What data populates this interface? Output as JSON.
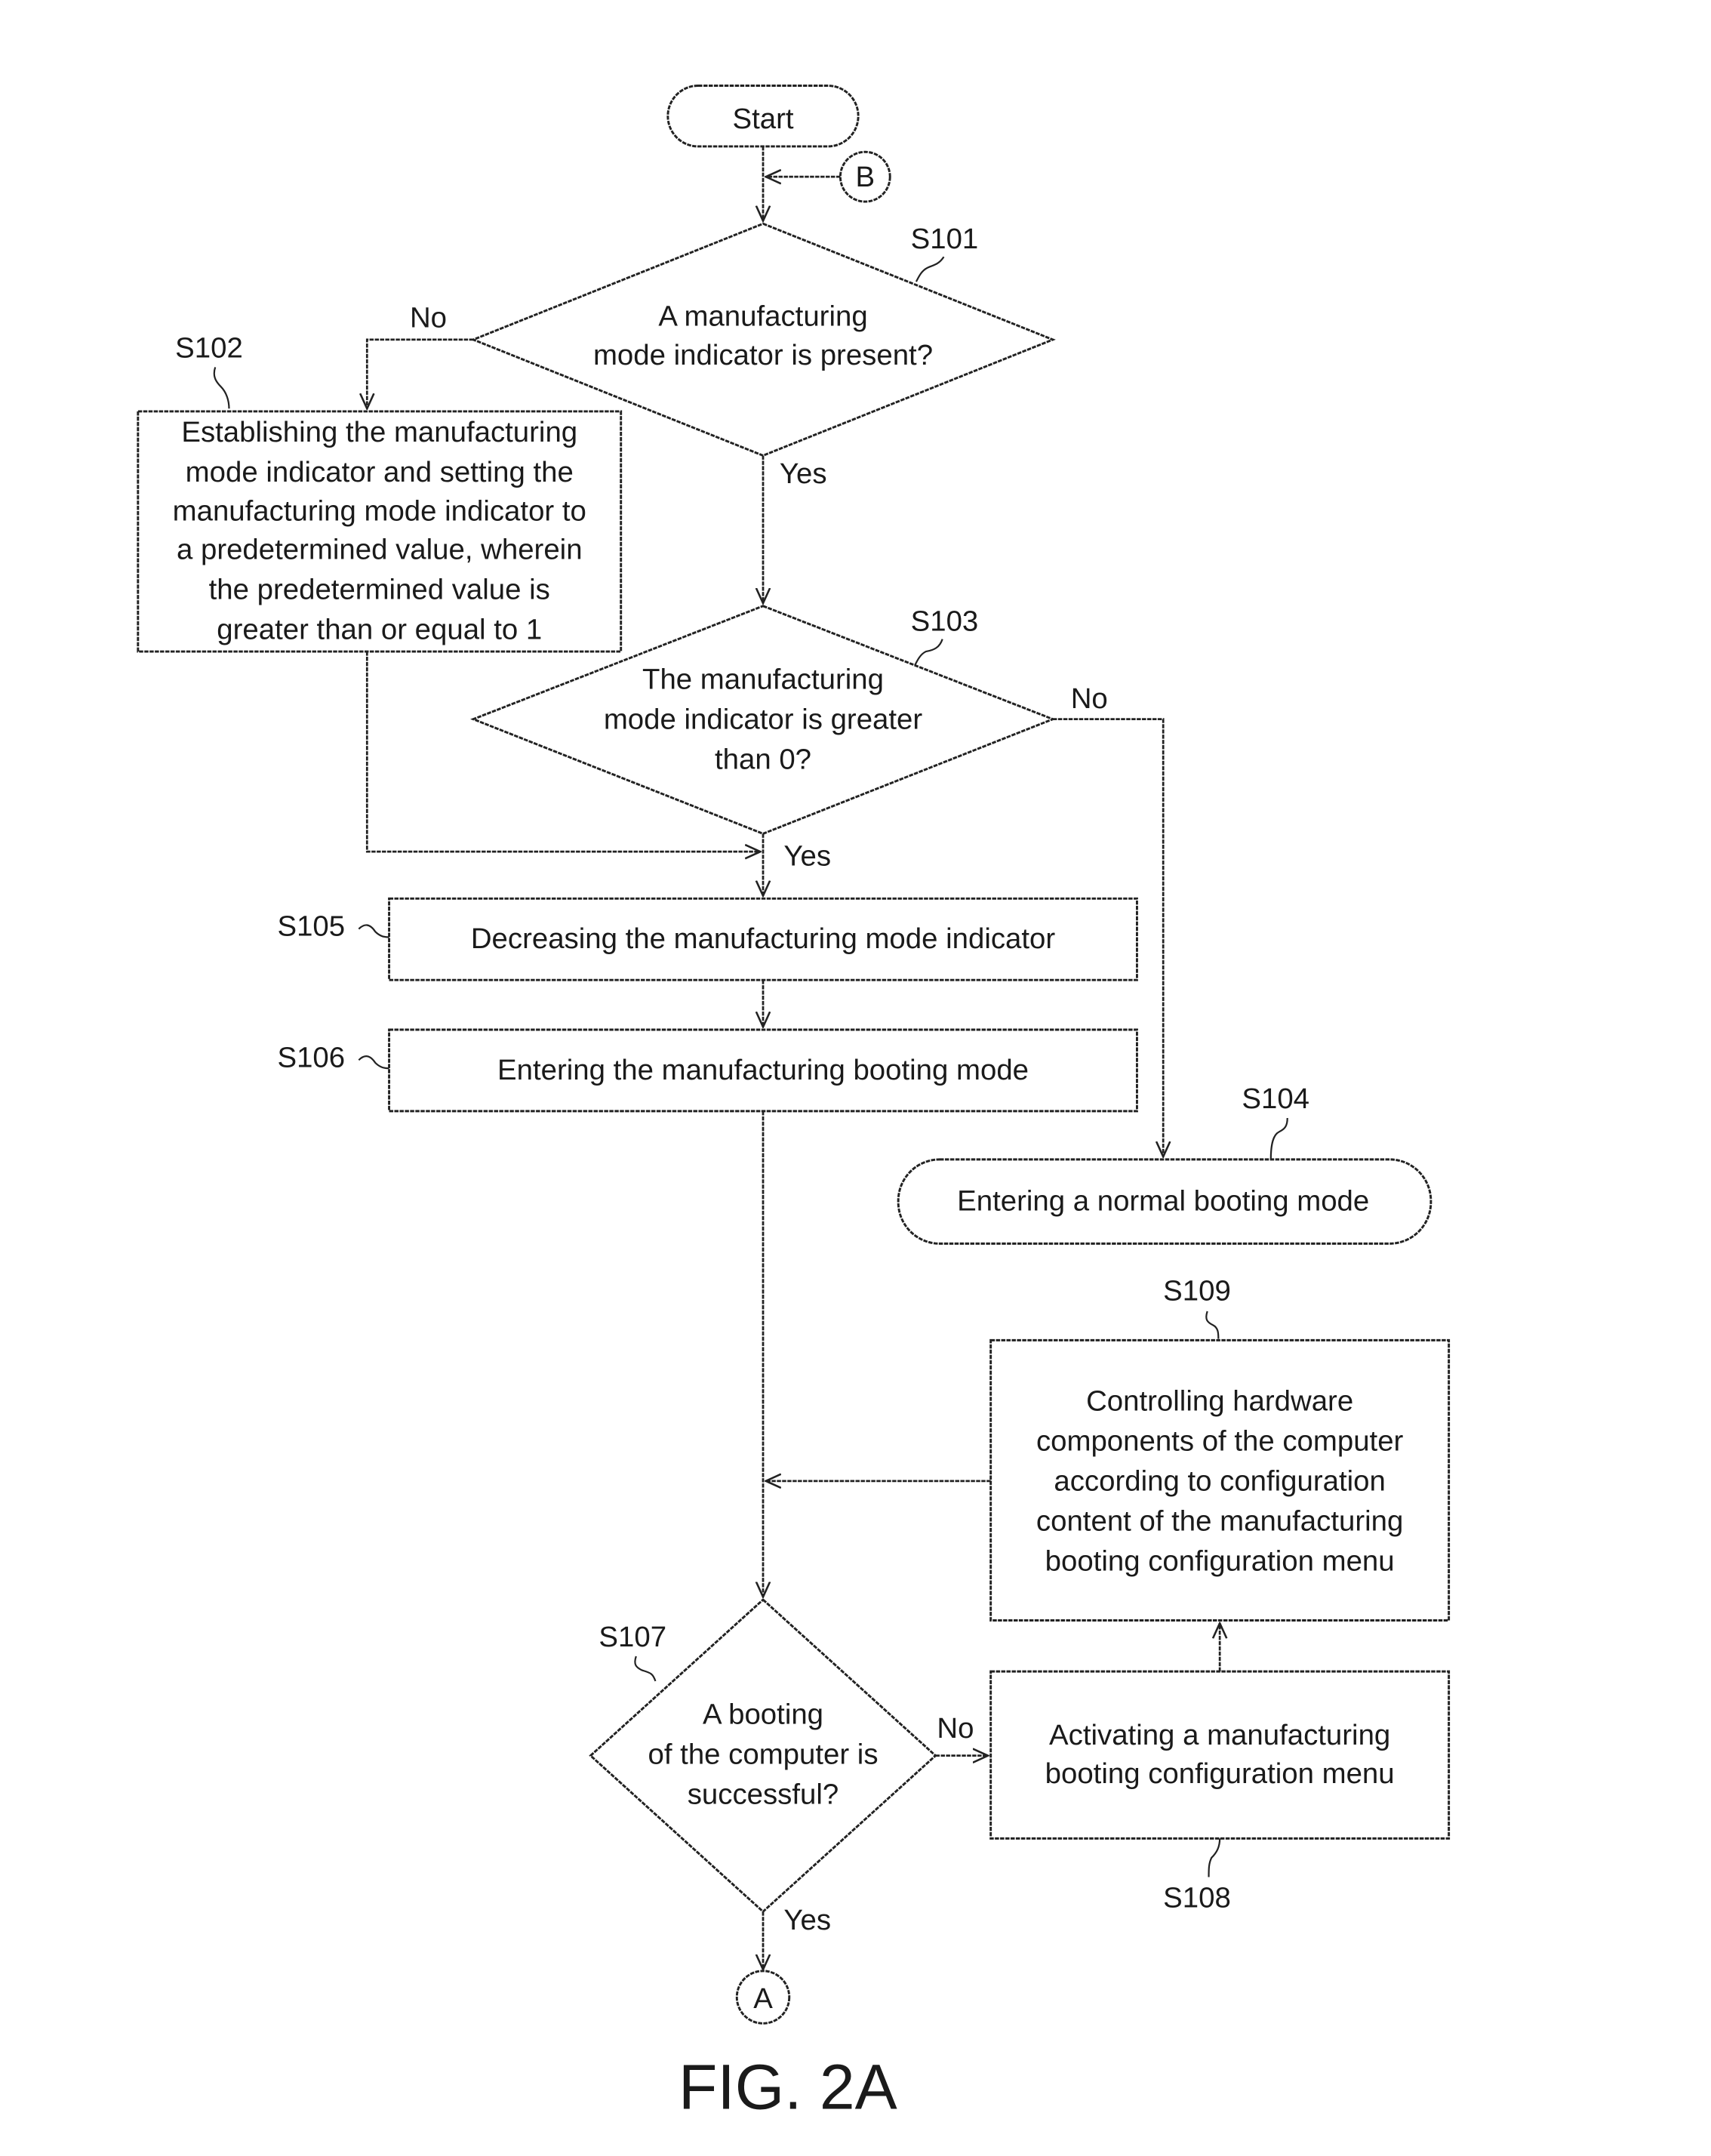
{
  "figure": {
    "caption": "FIG. 2A"
  },
  "connectors": {
    "top": "B",
    "bottom": "A"
  },
  "edge_labels": {
    "s101_no": "No",
    "s101_yes": "Yes",
    "s103_no": "No",
    "s103_yes": "Yes",
    "s107_no": "No",
    "s107_yes": "Yes"
  },
  "nodes": {
    "start": {
      "text": "Start"
    },
    "s101": {
      "id": "S101",
      "lines": [
        "A manufacturing",
        "mode indicator is present?"
      ]
    },
    "s102": {
      "id": "S102",
      "lines": [
        "Establishing the manufacturing",
        "mode indicator and setting the",
        "manufacturing mode indicator to",
        "a predetermined value, wherein",
        "the predetermined value is",
        "greater than or equal to 1"
      ]
    },
    "s103": {
      "id": "S103",
      "lines": [
        "The manufacturing",
        "mode indicator is greater",
        "than 0?"
      ]
    },
    "s104": {
      "id": "S104",
      "text": "Entering a normal booting mode"
    },
    "s105": {
      "id": "S105",
      "text": "Decreasing the manufacturing mode indicator"
    },
    "s106": {
      "id": "S106",
      "text": "Entering the manufacturing booting mode"
    },
    "s107": {
      "id": "S107",
      "lines": [
        "A booting",
        "of the computer is",
        "successful?"
      ]
    },
    "s108": {
      "id": "S108",
      "lines": [
        "Activating  a  manufacturing",
        "booting configuration menu"
      ]
    },
    "s109": {
      "id": "S109",
      "lines": [
        "Controlling hardware",
        "components of the computer",
        "according to configuration",
        "content of the manufacturing",
        "booting configuration menu"
      ]
    }
  }
}
